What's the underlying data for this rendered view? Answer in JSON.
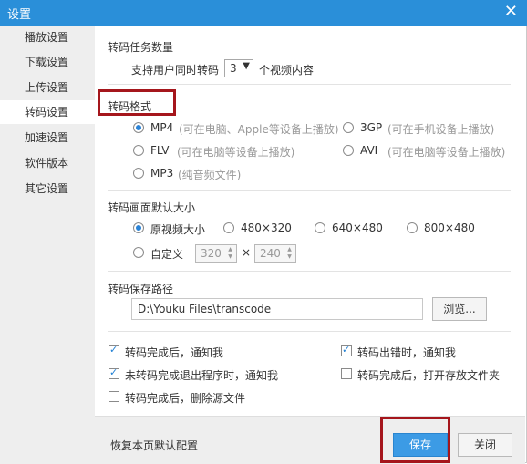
{
  "window": {
    "title": "设置",
    "close_symbol": "✕"
  },
  "sidebar": {
    "items": [
      {
        "label": "播放设置"
      },
      {
        "label": "下载设置"
      },
      {
        "label": "上传设置"
      },
      {
        "label": "转码设置"
      },
      {
        "label": "加速设置"
      },
      {
        "label": "软件版本"
      },
      {
        "label": "其它设置"
      }
    ],
    "active_index": 3
  },
  "task_count": {
    "heading": "转码任务数量",
    "prefix": "支持用户同时转码",
    "value": "3",
    "suffix": "个视频内容"
  },
  "format": {
    "heading": "转码格式",
    "options": [
      {
        "name": "MP4",
        "hint": "(可在电脑、Apple等设备上播放)",
        "selected": true
      },
      {
        "name": "3GP",
        "hint": "(可在手机设备上播放)",
        "selected": false
      },
      {
        "name": "FLV",
        "hint": "(可在电脑等设备上播放)",
        "selected": false
      },
      {
        "name": "AVI",
        "hint": "(可在电脑等设备上播放)",
        "selected": false
      },
      {
        "name": "MP3",
        "hint": "(纯音频文件)",
        "selected": false
      }
    ]
  },
  "size": {
    "heading": "转码画面默认大小",
    "options": [
      {
        "label": "原视频大小",
        "selected": true
      },
      {
        "label": "480×320",
        "selected": false
      },
      {
        "label": "640×480",
        "selected": false
      },
      {
        "label": "800×480",
        "selected": false
      },
      {
        "label": "自定义",
        "selected": false
      }
    ],
    "custom_width": "320",
    "custom_height": "240",
    "times": "×"
  },
  "path": {
    "heading": "转码保存路径",
    "value": "D:\\Youku Files\\transcode",
    "browse_label": "浏览..."
  },
  "notify": [
    {
      "label": "转码完成后，通知我",
      "checked": true
    },
    {
      "label": "转码出错时，通知我",
      "checked": true
    },
    {
      "label": "未转码完成退出程序时，通知我",
      "checked": true
    },
    {
      "label": "转码完成后，打开存放文件夹",
      "checked": false
    },
    {
      "label": "转码完成后，删除源文件",
      "checked": false
    }
  ],
  "footer": {
    "restore_label": "恢复本页默认配置",
    "save_label": "保存",
    "close_label": "关闭"
  },
  "colors": {
    "titlebar": "#2a8fd9",
    "accent": "#3c9be5",
    "highlight": "#a5161c"
  }
}
